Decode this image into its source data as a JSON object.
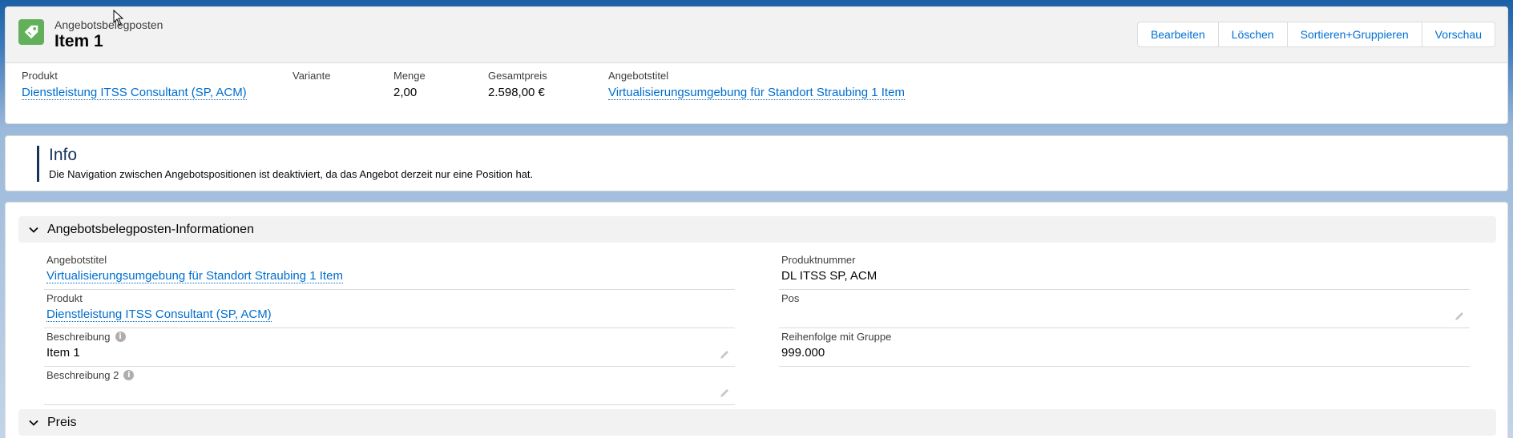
{
  "header": {
    "object_type": "Angebotsbelegposten",
    "record_name": "Item 1",
    "icon": "price-tag-icon",
    "actions": [
      "Bearbeiten",
      "Löschen",
      "Sortieren+Gruppieren",
      "Vorschau"
    ]
  },
  "highlights": {
    "produkt_label": "Produkt",
    "produkt_value": "Dienstleistung ITSS Consultant (SP, ACM)",
    "variante_label": "Variante",
    "variante_value": "",
    "menge_label": "Menge",
    "menge_value": "2,00",
    "gesamtpreis_label": "Gesamtpreis",
    "gesamtpreis_value": "2.598,00 €",
    "angebotstitel_label": "Angebotstitel",
    "angebotstitel_value": "Virtualisierungsumgebung für Standort Straubing 1 Item"
  },
  "info": {
    "title": "Info",
    "text": "Die Navigation zwischen Angebotspositionen ist deaktiviert, da das Angebot derzeit nur eine Position hat."
  },
  "section_info": {
    "title": "Angebotsbelegposten-Informationen",
    "fields": {
      "angebotstitel_label": "Angebotstitel",
      "angebotstitel_value": "Virtualisierungsumgebung für Standort Straubing 1 Item",
      "produktnummer_label": "Produktnummer",
      "produktnummer_value": "DL ITSS SP, ACM",
      "produkt_label": "Produkt",
      "produkt_value": "Dienstleistung ITSS Consultant (SP, ACM)",
      "pos_label": "Pos",
      "pos_value": "",
      "beschreibung_label": "Beschreibung",
      "beschreibung_value": "Item 1",
      "reihenfolge_label": "Reihenfolge mit Gruppe",
      "reihenfolge_value": "999.000",
      "beschreibung2_label": "Beschreibung 2",
      "beschreibung2_value": ""
    }
  },
  "section_preis": {
    "title": "Preis"
  },
  "colors": {
    "brand_link": "#006dcc",
    "icon_green": "#62b15a",
    "info_accent": "#16325c"
  }
}
